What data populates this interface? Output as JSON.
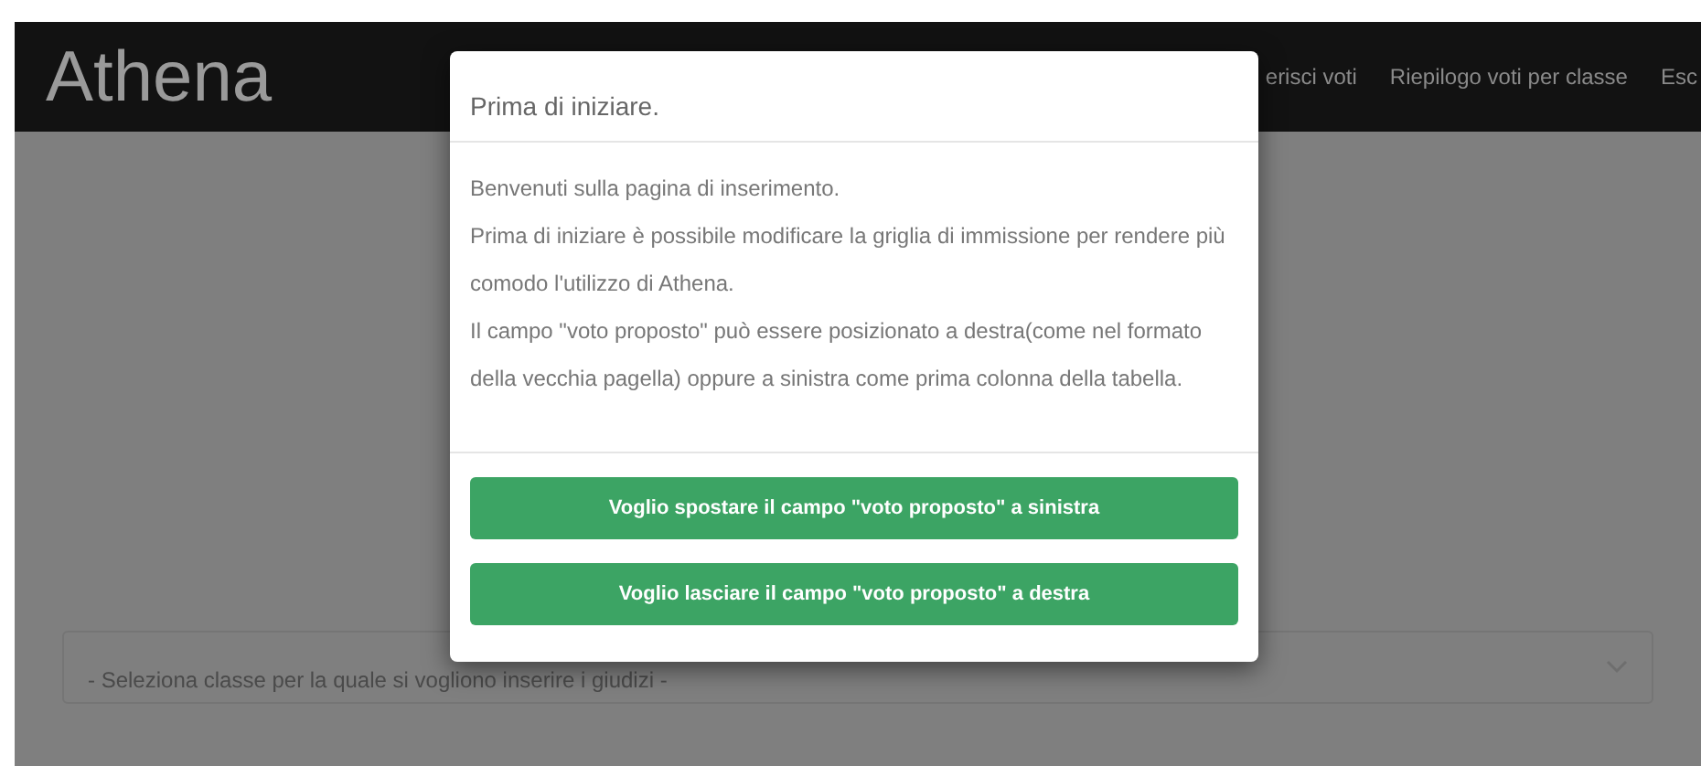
{
  "navbar": {
    "brand": "Athena",
    "links": [
      {
        "label": "erisci voti"
      },
      {
        "label": "Riepilogo voti per classe"
      },
      {
        "label": "Esc"
      }
    ]
  },
  "class_select": {
    "placeholder": "- Seleziona classe per la quale si vogliono inserire i giudizi -"
  },
  "modal": {
    "title": "Prima di iniziare.",
    "lines": [
      "Benvenuti sulla pagina di inserimento.",
      "Prima di iniziare è possibile modificare la griglia di immissione per rendere più comodo l'utilizzo di Athena.",
      "Il campo \"voto proposto\" può essere posizionato a destra(come nel formato della vecchia pagella) oppure a sinistra come prima colonna della tabella."
    ],
    "buttons": [
      {
        "label": "Voglio spostare il campo \"voto proposto\" a sinistra"
      },
      {
        "label": "Voglio lasciare il campo \"voto proposto\" a destra"
      }
    ]
  }
}
